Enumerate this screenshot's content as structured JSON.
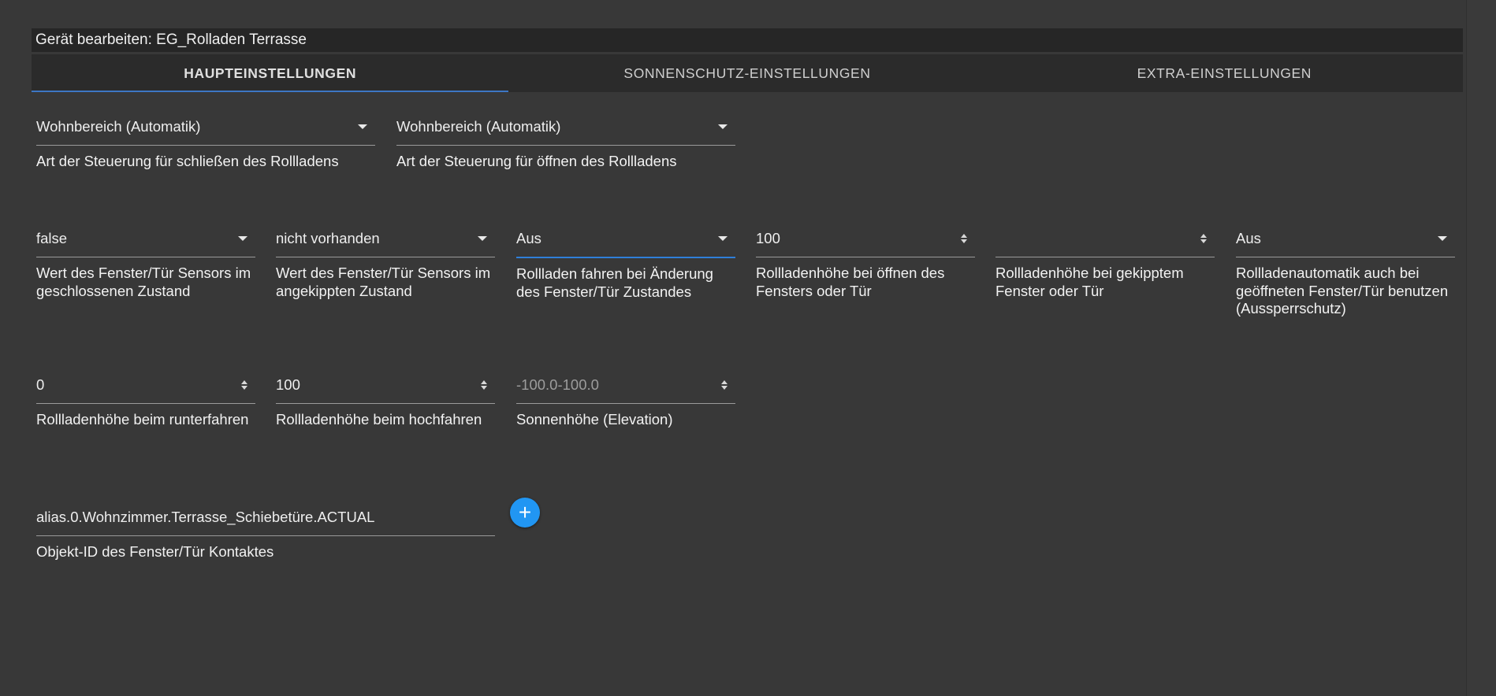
{
  "dialog": {
    "title": "Gerät bearbeiten: EG_Rolladen Terrasse"
  },
  "tabs": [
    {
      "label": "HAUPTEINSTELLUNGEN",
      "active": true
    },
    {
      "label": "SONNENSCHUTZ-EINSTELLUNGEN",
      "active": false
    },
    {
      "label": "EXTRA-EINSTELLUNGEN",
      "active": false
    }
  ],
  "fields": {
    "close_control": {
      "value": "Wohnbereich (Automatik)",
      "label": "Art der Steuerung für schließen des Rollladens"
    },
    "open_control": {
      "value": "Wohnbereich (Automatik)",
      "label": "Art der Steuerung für öffnen des Rollladens"
    },
    "sensor_closed": {
      "value": "false",
      "label": "Wert des Fenster/Tür Sensors im geschlossenen Zustand"
    },
    "sensor_tilted": {
      "value": "nicht vorhanden",
      "label": "Wert des Fenster/Tür Sensors im angekippten Zustand"
    },
    "drive_on_change": {
      "value": "Aus",
      "label": "Rollladen fahren bei Änderung des Fenster/Tür Zustandes"
    },
    "height_on_open": {
      "value": "100",
      "label": "Rollladenhöhe bei öffnen des Fensters oder Tür"
    },
    "height_on_tilt": {
      "value": "",
      "label": "Rollladenhöhe bei gekipptem Fenster oder Tür"
    },
    "lockout_protection": {
      "value": "Aus",
      "label": "Rollladenautomatik auch bei geöffneten Fenster/Tür benutzen (Aussperrschutz)"
    },
    "height_down": {
      "value": "0",
      "label": "Rollladenhöhe beim runterfahren"
    },
    "height_up": {
      "value": "100",
      "label": "Rollladenhöhe beim hochfahren"
    },
    "sun_elevation": {
      "placeholder": "-100.0-100.0",
      "label": "Sonnenhöhe (Elevation)"
    },
    "contact_id": {
      "value": "alias.0.Wohnzimmer.Terrasse_Schiebetüre.ACTUAL",
      "label": "Objekt-ID des Fenster/Tür Kontaktes"
    }
  },
  "add_button": {
    "icon": "plus-icon",
    "color": "#2196f3"
  },
  "colors": {
    "background": "#383838",
    "accent": "#2f7fd9",
    "tab_indicator": "#3d77c4"
  }
}
